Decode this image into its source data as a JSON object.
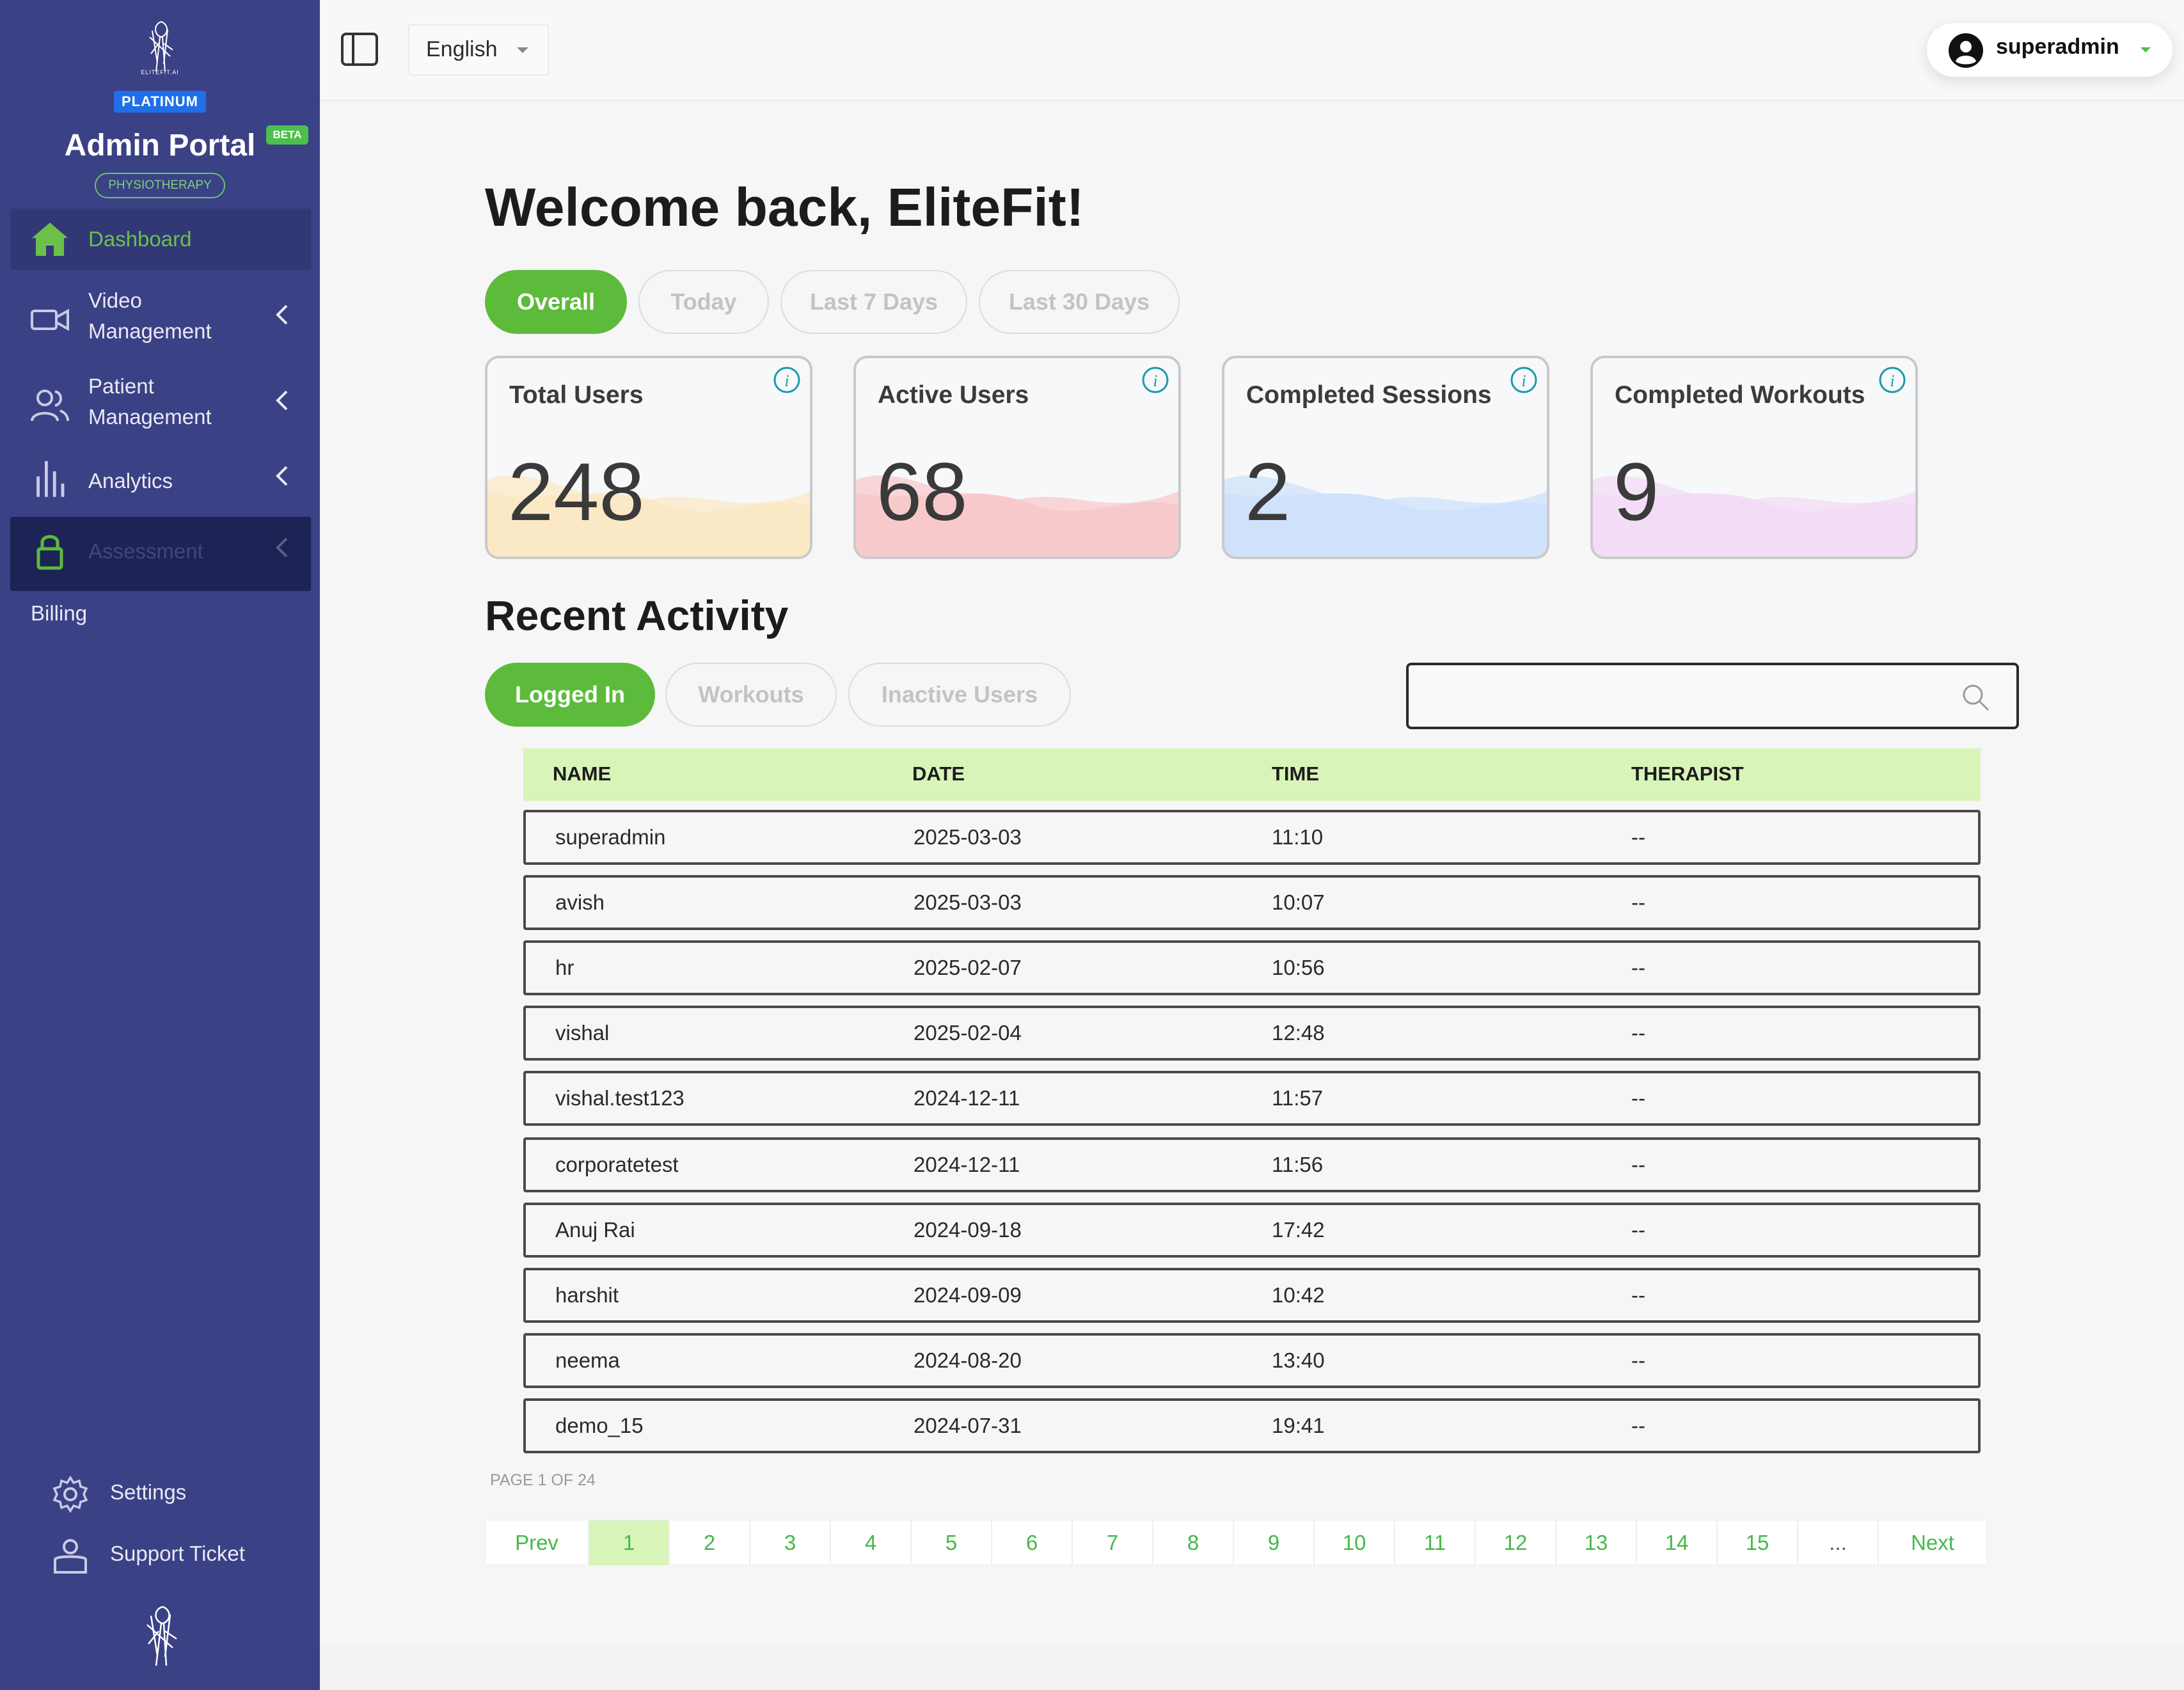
{
  "sidebar": {
    "brand_small": "ELITEFIT.AI",
    "plan_badge": "PLATINUM",
    "portal_title": "Admin Portal",
    "beta_badge": "BETA",
    "portal_subtitle": "PHYSIOTHERAPY",
    "items": [
      {
        "label": "Dashboard",
        "icon": "home-icon",
        "active": true
      },
      {
        "label": "Video\nManagement",
        "icon": "video-camera-icon"
      },
      {
        "label": "Patient\nManagement",
        "icon": "users-icon"
      },
      {
        "label": "Analytics",
        "icon": "bar-chart-icon"
      },
      {
        "label": "Assessment",
        "icon": "lock-icon",
        "locked": true
      },
      {
        "label": "Billing"
      }
    ],
    "bottom_items": [
      {
        "label": "Settings",
        "icon": "gear-icon"
      },
      {
        "label": "Support Ticket",
        "icon": "support-ticket-icon"
      }
    ]
  },
  "topbar": {
    "language": "English",
    "username": "superadmin"
  },
  "main": {
    "welcome": "Welcome back, EliteFit!",
    "range_tabs": [
      "Overall",
      "Today",
      "Last 7 Days",
      "Last 30 Days"
    ],
    "active_range_tab": "Overall",
    "stats": [
      {
        "title": "Total Users",
        "value": "248",
        "color": "#fbe9c6"
      },
      {
        "title": "Active Users",
        "value": "68",
        "color": "#f8c9cb"
      },
      {
        "title": "Completed Sessions",
        "value": "2",
        "color": "#cfe2fb"
      },
      {
        "title": "Completed Workouts",
        "value": "9",
        "color": "#f3dcf6"
      }
    ],
    "recent_title": "Recent Activity",
    "activity_tabs": [
      "Logged In",
      "Workouts",
      "Inactive Users"
    ],
    "active_activity_tab": "Logged In",
    "search_placeholder": "",
    "table": {
      "columns": [
        "NAME",
        "DATE",
        "TIME",
        "THERAPIST"
      ],
      "rows": [
        [
          "superadmin",
          "2025-03-03",
          "11:10",
          "--"
        ],
        [
          "avish",
          "2025-03-03",
          "10:07",
          "--"
        ],
        [
          "hr",
          "2025-02-07",
          "10:56",
          "--"
        ],
        [
          "vishal",
          "2025-02-04",
          "12:48",
          "--"
        ],
        [
          "vishal.test123",
          "2024-12-11",
          "11:57",
          "--"
        ],
        [
          "corporatetest",
          "2024-12-11",
          "11:56",
          "--"
        ],
        [
          "Anuj Rai",
          "2024-09-18",
          "17:42",
          "--"
        ],
        [
          "harshit",
          "2024-09-09",
          "10:42",
          "--"
        ],
        [
          "neema",
          "2024-08-20",
          "13:40",
          "--"
        ],
        [
          "demo_15",
          "2024-07-31",
          "19:41",
          "--"
        ]
      ]
    },
    "page_info": "PAGE 1 OF 24",
    "pagination": [
      "Prev",
      "1",
      "2",
      "3",
      "4",
      "5",
      "6",
      "7",
      "8",
      "9",
      "10",
      "11",
      "12",
      "13",
      "14",
      "15",
      "...",
      "Next"
    ],
    "current_page": "1"
  },
  "colors": {
    "sidebar": "#3b4185",
    "accent_green": "#5dbb3c",
    "plan_blue": "#1f6fe8",
    "table_header": "#d8f4b8"
  }
}
